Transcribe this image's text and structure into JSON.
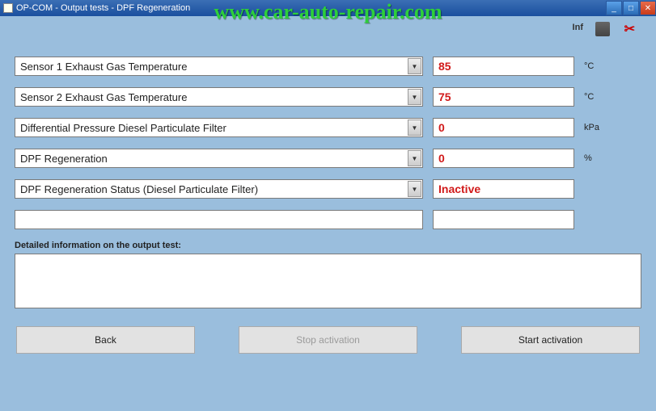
{
  "window": {
    "title": "OP-COM - Output tests - DPF Regeneration"
  },
  "watermark": "www.car-auto-repair.com",
  "header": {
    "info_label": "Inf"
  },
  "rows": [
    {
      "label": "Sensor 1 Exhaust Gas Temperature",
      "value": "85",
      "unit": "°C",
      "has_dropdown": true
    },
    {
      "label": "Sensor 2 Exhaust Gas Temperature",
      "value": "75",
      "unit": "°C",
      "has_dropdown": true
    },
    {
      "label": "Differential Pressure Diesel Particulate Filter",
      "value": "0",
      "unit": "kPa",
      "has_dropdown": true
    },
    {
      "label": "DPF Regeneration",
      "value": "0",
      "unit": "%",
      "has_dropdown": true
    },
    {
      "label": "DPF Regeneration Status (Diesel Particulate Filter)",
      "value": "Inactive",
      "unit": "",
      "has_dropdown": true
    },
    {
      "label": "",
      "value": "",
      "unit": "",
      "has_dropdown": false
    }
  ],
  "detail": {
    "label": "Detailed information on the output test:",
    "content": ""
  },
  "buttons": {
    "back": "Back",
    "stop": "Stop activation",
    "start": "Start activation"
  }
}
